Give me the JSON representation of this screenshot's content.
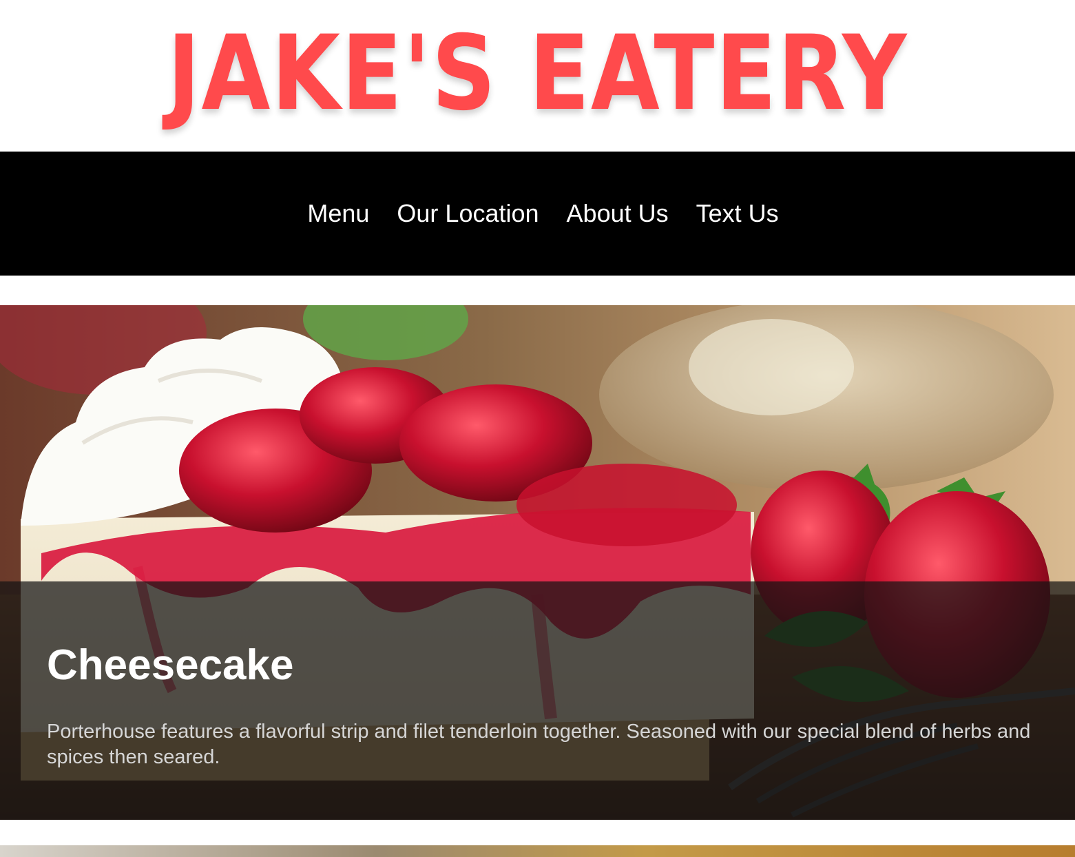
{
  "header": {
    "logo_text": "JAKE'S EATERY"
  },
  "nav": {
    "items": [
      {
        "label": "Menu"
      },
      {
        "label": "Our Location"
      },
      {
        "label": "About Us"
      },
      {
        "label": "Text Us"
      }
    ]
  },
  "featured": {
    "title": "Cheesecake",
    "description": "Porterhouse features a flavorful strip and filet tenderloin together. Seasoned with our special blend of herbs and spices then seared."
  },
  "colors": {
    "brand": "#ff4a4c",
    "nav_background": "#000000",
    "nav_text": "#ffffff",
    "caption_overlay": "rgba(20,20,20,0.72)"
  }
}
